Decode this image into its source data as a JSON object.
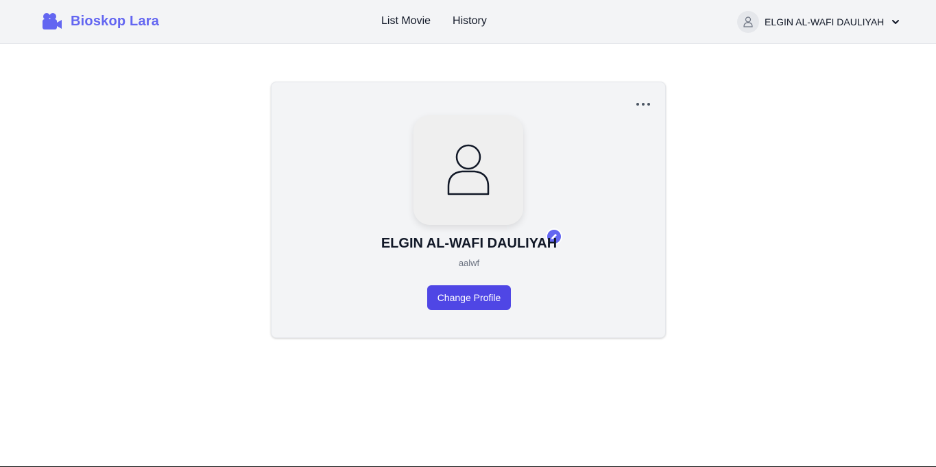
{
  "navbar": {
    "brand": {
      "name": "Bioskop Lara",
      "icon": "video-camera-icon",
      "color": "#6366f1"
    },
    "links": [
      {
        "label": "List Movie"
      },
      {
        "label": "History"
      }
    ],
    "user": {
      "name": "ELGIN AL-WAFI DAULIYAH",
      "icon": "user-icon",
      "dropdown_icon": "chevron-down-icon"
    }
  },
  "profile": {
    "name": "ELGIN AL-WAFI DAULIYAH",
    "username": "aalwf",
    "avatar_icon": "user-placeholder-icon",
    "edit_icon": "pencil-icon",
    "menu_icon": "ellipsis-icon",
    "change_button_label": "Change Profile"
  },
  "colors": {
    "accent": "#6366f1",
    "button": "#4f46e5",
    "navbar_bg": "#f3f4f6",
    "card_bg": "#f3f4f6"
  }
}
